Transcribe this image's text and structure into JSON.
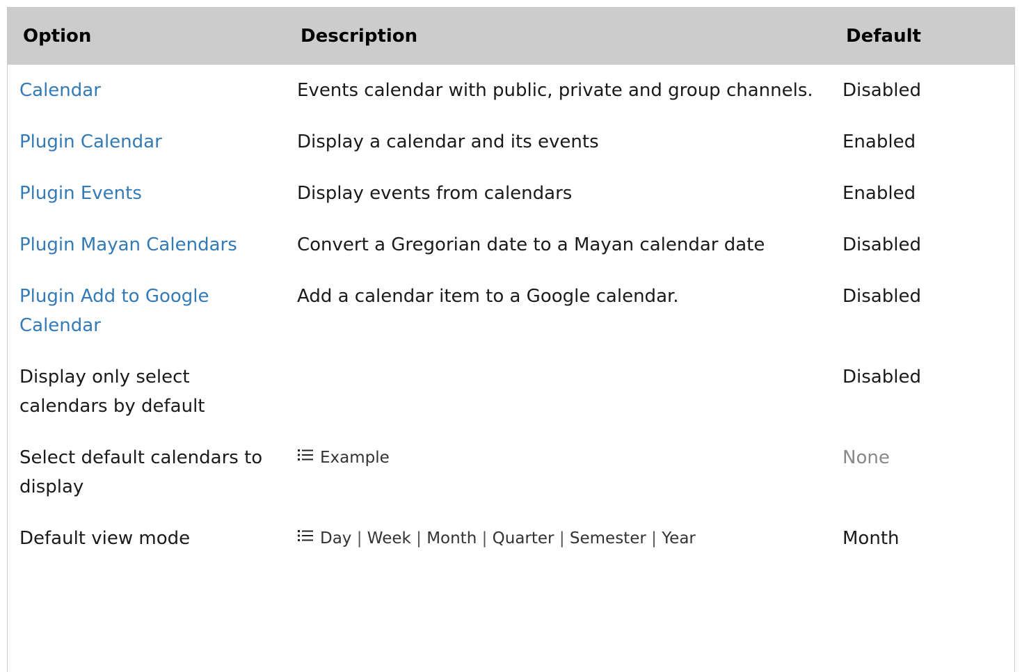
{
  "header": {
    "option": "Option",
    "description": "Description",
    "default": "Default"
  },
  "rows": [
    {
      "option": "Calendar",
      "option_is_link": true,
      "description": "Events calendar with public, private and group channels.",
      "default": "Disabled"
    },
    {
      "option": "Plugin Calendar",
      "option_is_link": true,
      "description": "Display a calendar and its events",
      "default": "Enabled"
    },
    {
      "option": "Plugin Events",
      "option_is_link": true,
      "description": "Display events from calendars",
      "default": "Enabled"
    },
    {
      "option": "Plugin Mayan Calendars",
      "option_is_link": true,
      "description": "Convert a Gregorian date to a Mayan calendar date",
      "default": "Disabled"
    },
    {
      "option": "Plugin Add to Google Calendar",
      "option_is_link": true,
      "description": "Add a calendar item to a Google calendar.",
      "default": "Disabled"
    },
    {
      "option": "Display only select calendars by default",
      "option_is_link": false,
      "description": "",
      "default": "Disabled"
    },
    {
      "option": "Select default calendars to display",
      "option_is_link": false,
      "description_list": "Example",
      "default": "None"
    },
    {
      "option": "Default view mode",
      "option_is_link": false,
      "description_options": [
        "Day",
        "Week",
        "Month",
        "Quarter",
        "Semester",
        "Year"
      ],
      "separator": "|",
      "default": "Month"
    }
  ],
  "icons": {
    "list": "list-icon"
  },
  "colors": {
    "link": "#337ab7",
    "header_bg": "#cccccc",
    "muted": "#888888"
  }
}
